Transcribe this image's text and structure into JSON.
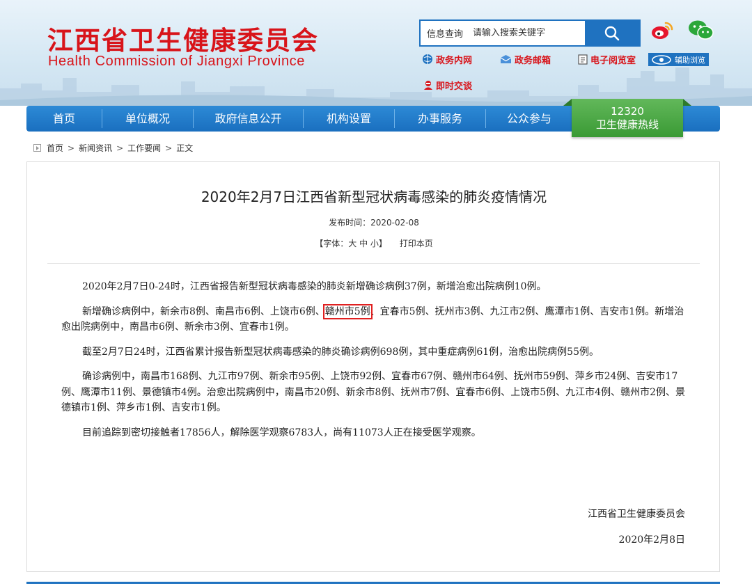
{
  "header": {
    "logo_cn": "江西省卫生健康委员会",
    "logo_en": "Health Commission of Jiangxi Province",
    "search": {
      "label": "信息查询",
      "placeholder": "请输入搜索关键字"
    },
    "quick_links": {
      "gov_net": "政务内网",
      "gov_mail": "政务邮箱",
      "reading_room": "电子阅览室",
      "chat": "即时交谈"
    },
    "accessibility": "辅助浏览"
  },
  "nav": {
    "items": [
      "首页",
      "单位概况",
      "政府信息公开",
      "机构设置",
      "办事服务",
      "公众参与"
    ],
    "hotline_number": "12320",
    "hotline_label": "卫生健康热线"
  },
  "breadcrumb": [
    "首页",
    "新闻资讯",
    "工作要闻",
    "正文"
  ],
  "article": {
    "title": "2020年2月7日江西省新型冠状病毒感染的肺炎疫情情况",
    "publish_time": "发布时间：2020-02-08",
    "font_size_tool": "【字体：大 中 小】",
    "print_label": "打印本页",
    "p1": "2020年2月7日0-24时，江西省报告新型冠状病毒感染的肺炎新增确诊病例37例，新增治愈出院病例10例。",
    "p2_before": "新增确诊病例中，新余市8例、南昌市6例、上饶市6例、",
    "p2_highlight": "赣州市5例",
    "p2_after": "、宜春市5例、抚州市3例、九江市2例、鹰潭市1例、吉安市1例。新增治愈出院病例中，南昌市6例、新余市3例、宜春市1例。",
    "p3": "截至2月7日24时，江西省累计报告新型冠状病毒感染的肺炎确诊病例698例，其中重症病例61例，治愈出院病例55例。",
    "p4": "确诊病例中，南昌市168例、九江市97例、新余市95例、上饶市92例、宜春市67例、赣州市64例、抚州市59例、萍乡市24例、吉安市17例、鹰潭市11例、景德镇市4例。治愈出院病例中，南昌市20例、新余市8例、抚州市7例、宜春市6例、上饶市5例、九江市4例、赣州市2例、景德镇市1例、萍乡市1例、吉安市1例。",
    "p5": "目前追踪到密切接触者17856人，解除医学观察6783人，尚有11073人正在接受医学观察。",
    "signature_org": "江西省卫生健康委员会",
    "signature_date": "2020年2月8日"
  },
  "colors": {
    "brand_red": "#d8141a",
    "brand_blue": "#1f72c0",
    "hotline_green": "#3a9a35",
    "highlight_box": "#e02020"
  }
}
